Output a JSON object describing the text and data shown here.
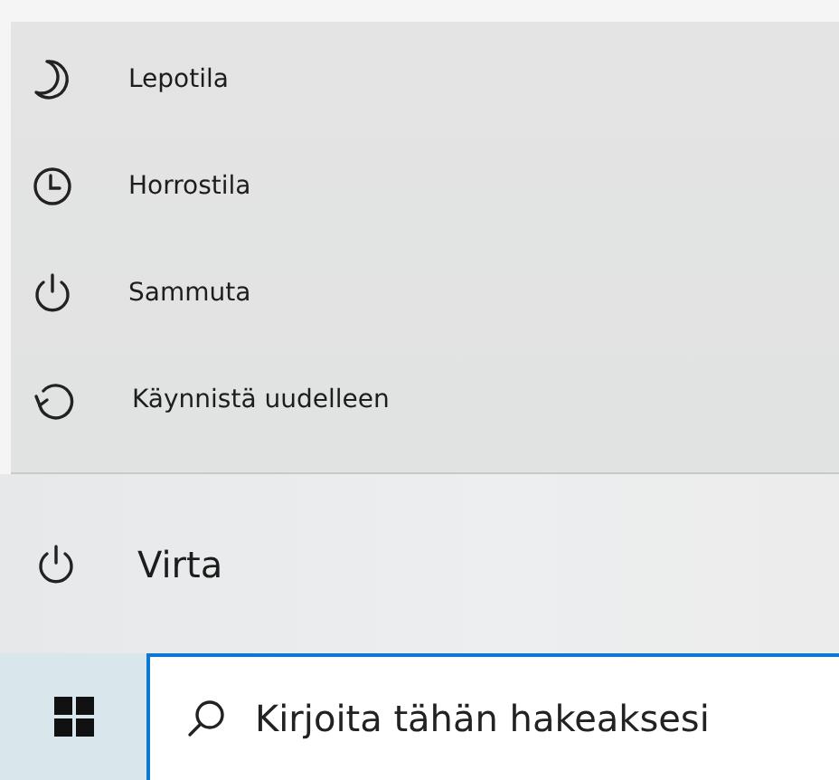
{
  "power_menu": {
    "items": [
      {
        "label": "Lepotila"
      },
      {
        "label": "Horrostila"
      },
      {
        "label": "Sammuta"
      },
      {
        "label": "Käynnistä uudelleen"
      }
    ]
  },
  "start_menu": {
    "power_button": {
      "label": "Virta"
    }
  },
  "taskbar": {
    "search": {
      "placeholder": "Kirjoita tähän hakeaksesi"
    }
  }
}
